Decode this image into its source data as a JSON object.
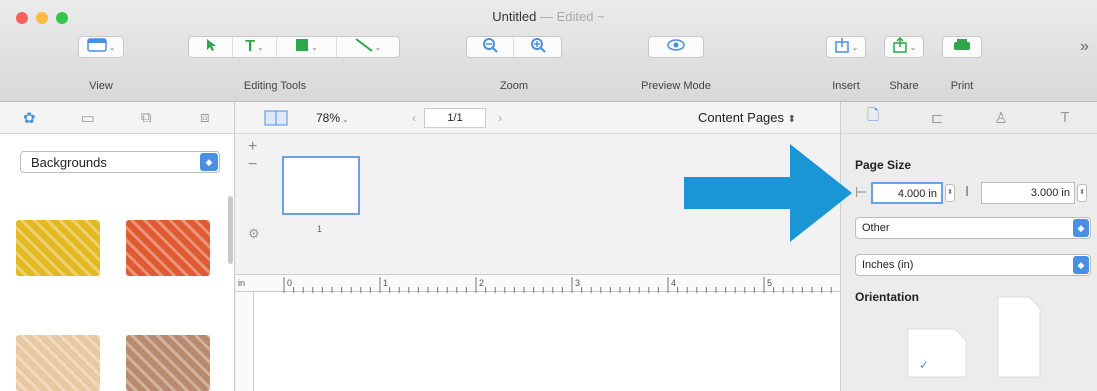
{
  "window": {
    "title": "Untitled",
    "separator": "—",
    "status": "Edited ~"
  },
  "toolbar": {
    "view_label": "View",
    "editing_tools_label": "Editing Tools",
    "zoom_label": "Zoom",
    "preview_label": "Preview Mode",
    "insert_label": "Insert",
    "share_label": "Share",
    "print_label": "Print",
    "overflow_glyph": "»"
  },
  "left_panel": {
    "tabs": [
      "✿",
      "▭",
      "⧉",
      "⧈"
    ],
    "category_value": "Backgrounds",
    "stepper_glyph": "◆",
    "thumbnails": [
      {
        "name": "yellow-texture",
        "color": "#e3b820"
      },
      {
        "name": "red-texture",
        "color": "#e05a32"
      },
      {
        "name": "speckle-texture",
        "color": "#e8c8a0"
      },
      {
        "name": "wood-texture",
        "color": "#b98a6e"
      }
    ]
  },
  "center": {
    "zoom_value": "78%",
    "page_indicator": "1/1",
    "content_pages_label": "Content Pages",
    "page_number": "1",
    "ruler_unit": "in",
    "ruler_marks": [
      "0",
      "1",
      "2",
      "3",
      "4",
      "5"
    ],
    "add_glyph": "+",
    "remove_glyph": "−",
    "gear_glyph": "⚙"
  },
  "inspector": {
    "tabs": [
      "🗋",
      "⊏",
      "♙",
      "T"
    ],
    "page_size_heading": "Page Size",
    "width_value": "4.000 in",
    "height_value": "3.000 in",
    "size_preset": "Other",
    "units": "Inches (in)",
    "orientation_heading": "Orientation",
    "check_glyph": "✓"
  },
  "colors": {
    "accent": "#4a90e2",
    "arrow": "#1a96d4"
  }
}
